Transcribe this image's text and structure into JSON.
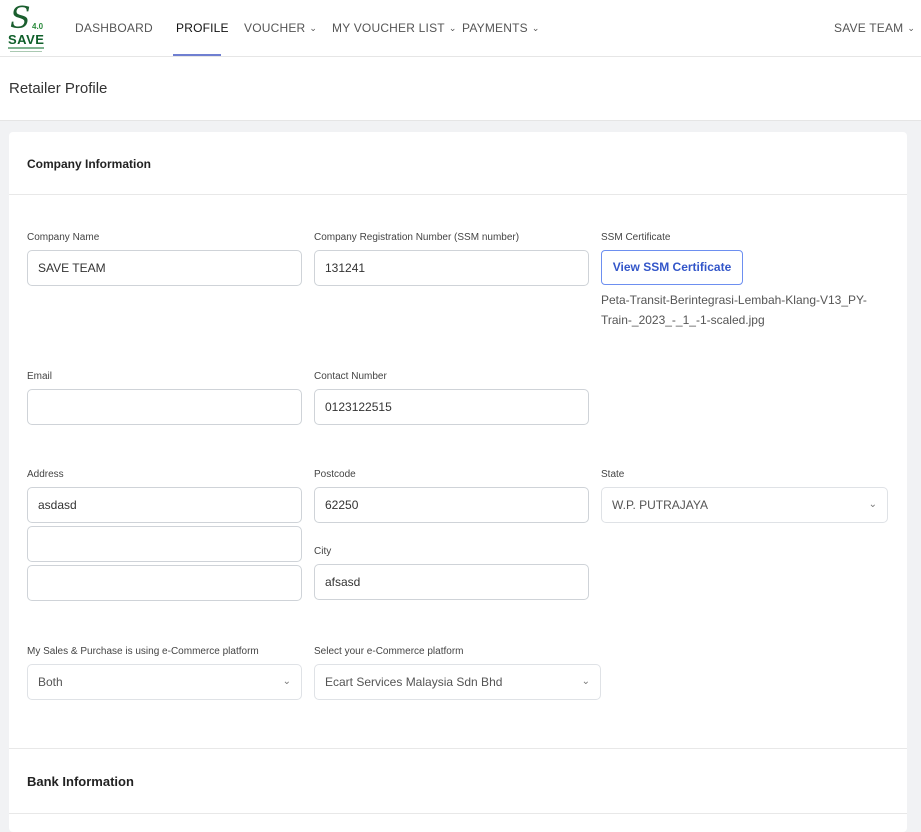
{
  "logo": {
    "mark": "S",
    "version": "4.0",
    "word": "SAVE"
  },
  "nav": {
    "dashboard": "DASHBOARD",
    "profile": "PROFILE",
    "voucher": "VOUCHER",
    "my_voucher_list": "MY VOUCHER LIST",
    "payments": "PAYMENTS",
    "account": "SAVE TEAM",
    "caret": "⌄"
  },
  "page": {
    "title": "Retailer Profile"
  },
  "company": {
    "section_title": "Company Information",
    "company_name_label": "Company Name",
    "company_name_value": "SAVE TEAM",
    "reg_label": "Company Registration Number (SSM number)",
    "reg_value": "131241",
    "ssm_label": "SSM Certificate",
    "ssm_button": "View SSM Certificate",
    "ssm_filename": "Peta-Transit-Berintegrasi-Lembah-Klang-V13_PY-Train-_2023_-_1_-1-scaled.jpg",
    "email_label": "Email",
    "email_value": "",
    "contact_label": "Contact Number",
    "contact_value": "0123122515",
    "address_label": "Address",
    "address_line1": "asdasd",
    "address_line2": "",
    "address_line3": "",
    "postcode_label": "Postcode",
    "postcode_value": "62250",
    "state_label": "State",
    "state_value": "W.P. PUTRAJAYA",
    "city_label": "City",
    "city_value": "afsasd",
    "ecommerce_label": "My Sales & Purchase is using e-Commerce platform",
    "ecommerce_value": "Both",
    "platform_label": "Select your e-Commerce platform",
    "platform_value": "Ecart Services Malaysia Sdn Bhd"
  },
  "bank": {
    "section_title": "Bank Information"
  },
  "colors": {
    "accent": "#6d8ff0",
    "brand": "#1a5e2e"
  }
}
